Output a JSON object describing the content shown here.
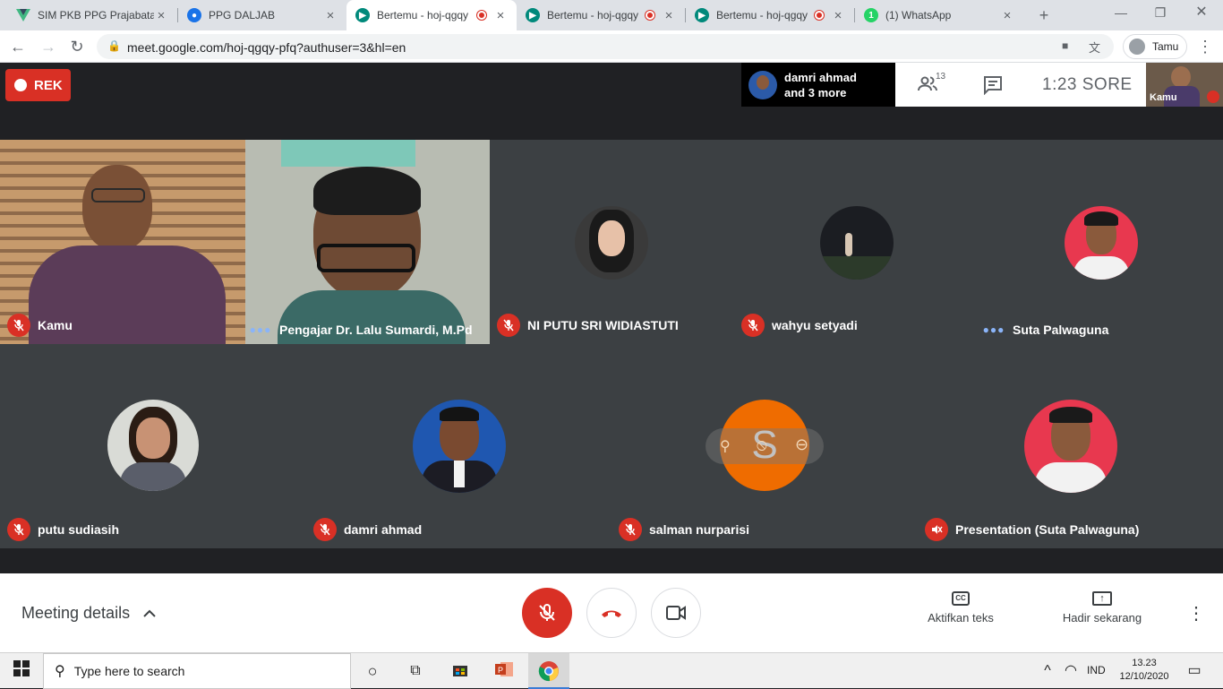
{
  "browser": {
    "tabs": [
      {
        "title": "SIM PKB PPG Prajabatan",
        "favicon": "vue-icon",
        "color": "#42b883"
      },
      {
        "title": "PPG DALJAB",
        "favicon": "kemdikbud-icon",
        "color": "#1a73e8"
      },
      {
        "title": "Bertemu - hoj-qgqy",
        "favicon": "meet-icon",
        "color": "#00897b",
        "recording": true,
        "active": true
      },
      {
        "title": "Bertemu - hoj-qgqy",
        "favicon": "meet-icon",
        "color": "#00897b",
        "recording": true
      },
      {
        "title": "Bertemu - hoj-qgqy",
        "favicon": "meet-icon",
        "color": "#00897b",
        "recording": true
      },
      {
        "title": "(1) WhatsApp",
        "favicon": "whatsapp-icon",
        "color": "#25d366",
        "badge": "1"
      }
    ],
    "url": "meet.google.com/hoj-qgqy-pfq?authuser=3&hl=en",
    "profile_label": "Tamu"
  },
  "meet": {
    "rec_label": "REK",
    "presenter_line1": "damri ahmad",
    "presenter_line2": "and 3 more",
    "participant_count": "13",
    "clock": "1:23  SORE",
    "self_label": "Kamu",
    "tiles": [
      {
        "name": "Kamu",
        "status": "muted"
      },
      {
        "name": "Pengajar Dr. Lalu Sumardi, M.Pd",
        "status": "speaking"
      },
      {
        "name": "NI PUTU SRI WIDIASTUTI",
        "status": "muted"
      },
      {
        "name": "wahyu setyadi",
        "status": "muted"
      },
      {
        "name": "Suta Palwaguna",
        "status": "speaking"
      },
      {
        "name": "putu sudiasih",
        "status": "muted"
      },
      {
        "name": "damri ahmad",
        "status": "muted"
      },
      {
        "name": "salman nurparisi",
        "status": "muted",
        "initial": "S"
      },
      {
        "name": "Presentation (Suta Palwaguna)",
        "status": "audio-off"
      }
    ],
    "meeting_details": "Meeting details",
    "captions_label": "Aktifkan teks",
    "present_label": "Hadir sekarang"
  },
  "taskbar": {
    "search_placeholder": "Type here to search",
    "lang": "IND",
    "time": "13.23",
    "date": "12/10/2020"
  },
  "colors": {
    "accent_red": "#d93025",
    "tile_bg": "#3c4043",
    "meet_bg": "#202124",
    "orange_avatar": "#ef6c00"
  }
}
